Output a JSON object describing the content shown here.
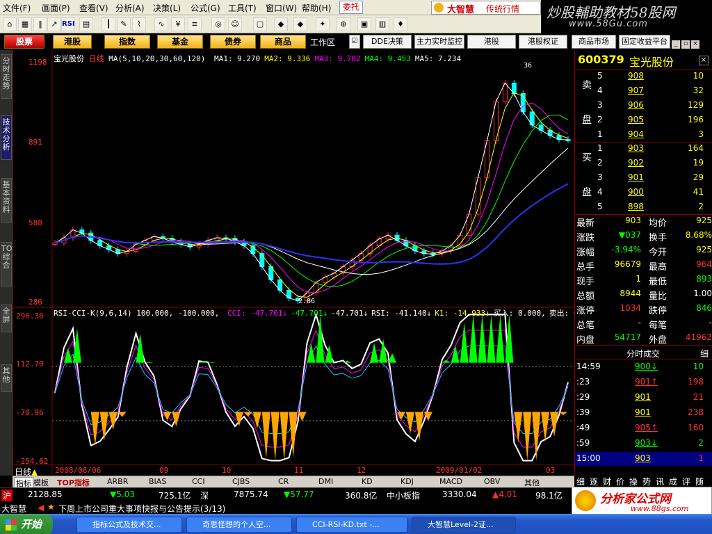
{
  "menu": [
    "文件(F)",
    "画面(P)",
    "查看(V)",
    "分析(A)",
    "决策(L)",
    "公式(G)",
    "工具(T)",
    "窗口(W)",
    "帮助(H)"
  ],
  "weituo": "委托",
  "brand": {
    "name": "大智慧",
    "sub": "传统行情"
  },
  "watermark_top": {
    "line1": "炒股輔助教材58股网",
    "line2": "www.58Gu.com"
  },
  "func_buttons": [
    "股票",
    "港股",
    "指数",
    "基金",
    "债券",
    "商品"
  ],
  "workzone": "工作区",
  "work_buttons": [
    "DDE决策",
    "主力实时监控",
    "港股",
    "港股权证",
    "商品市场",
    "固定收益平台"
  ],
  "left_tabs": [
    "分时走势",
    "技术分析",
    "基本资料",
    "TOP综合",
    "全屏",
    "其他"
  ],
  "chart": {
    "title": "宝光股份",
    "period": "日线",
    "ma_params": "MA(5,10,20,30,60,120)",
    "ma_readouts": [
      {
        "label": "MA1: 9.270",
        "color": "#ffffff"
      },
      {
        "label": "MA2: 9.336",
        "color": "#ffff00"
      },
      {
        "label": "MA3: 9.702",
        "color": "#ff00ff"
      },
      {
        "label": "MA4: 9.453",
        "color": "#00ff00"
      },
      {
        "label": "MA5: 7.234",
        "color": "#ffffff"
      }
    ],
    "price_axis": [
      "1198",
      "891",
      "588",
      "286"
    ],
    "low_marker": "2.86",
    "high_marker": "36",
    "ind_title": "RSI-CCI-K(9,6,14)",
    "ind_vals": "100.000, -100.000,",
    "ind_readouts": [
      {
        "label": "CCI: -47.701↓",
        "color": "#ff00ff"
      },
      {
        "label": "-47.701↓",
        "color": "#00ff00"
      },
      {
        "label": "-47.701↓",
        "color": "#ffffff"
      },
      {
        "label": "RSI: -41.140↓",
        "color": "#ffffff"
      },
      {
        "label": "K1: -14.933↓",
        "color": "#ffff00"
      },
      {
        "label": "买入: 0.000,",
        "color": "#ffffff"
      },
      {
        "label": "卖出: 0.000,",
        "color": "#ffffff"
      }
    ],
    "ind_axis": [
      "296.36",
      "112.70",
      "-70.96",
      "-254.62"
    ],
    "date_axis": [
      "2008/08/06",
      "09",
      "10",
      "11",
      "12",
      "2009/01/02",
      "03"
    ],
    "bottom_label": "日线"
  },
  "chart_data": {
    "type": "line",
    "series": [
      {
        "values": [
          510,
          530,
          560,
          548,
          520,
          500,
          485,
          470,
          478,
          505,
          520,
          535,
          528,
          515,
          505,
          495,
          505,
          520,
          530,
          528,
          515,
          500,
          470,
          420,
          370,
          330,
          300,
          290,
          320,
          360,
          380,
          395,
          420,
          445,
          470,
          500,
          525,
          540,
          520,
          500,
          480,
          470,
          468,
          480,
          500,
          540,
          620,
          760,
          900,
          1050,
          1120,
          1080,
          1010,
          960,
          940,
          920,
          905,
          903
        ]
      }
    ]
  },
  "quote": {
    "code": "600379",
    "name": "宝光股份",
    "sell_label": [
      "卖",
      "盘"
    ],
    "buy_label": [
      "买",
      "盘"
    ],
    "sell": [
      [
        "5",
        "908",
        "10"
      ],
      [
        "4",
        "907",
        "32"
      ],
      [
        "3",
        "906",
        "129"
      ],
      [
        "2",
        "905",
        "196"
      ],
      [
        "1",
        "904",
        "3"
      ]
    ],
    "buy": [
      [
        "1",
        "903",
        "164"
      ],
      [
        "2",
        "902",
        "19"
      ],
      [
        "3",
        "901",
        "29"
      ],
      [
        "4",
        "900",
        "41"
      ],
      [
        "5",
        "898",
        "2"
      ]
    ],
    "stats": [
      [
        "最新",
        "903",
        "#ffff00",
        "均价",
        "925",
        "#ffff00"
      ],
      [
        "涨跌",
        "▼037",
        "#00ff00",
        "换手",
        "8.68%",
        "#ffff00"
      ],
      [
        "涨幅",
        "-3.94%",
        "#00ff00",
        "今开",
        "925",
        "#ffff00"
      ],
      [
        "总手",
        "96679",
        "#ffff00",
        "最高",
        "964",
        "#ff3030"
      ],
      [
        "现手",
        "1",
        "#ffff00",
        "最低",
        "893",
        "#00ff00"
      ],
      [
        "总额",
        "8944",
        "#ffff00",
        "量比",
        "1.00",
        "#ffffff"
      ],
      [
        "涨停",
        "1034",
        "#ff3030",
        "跌停",
        "846",
        "#00ff00"
      ],
      [
        "总笔",
        "-",
        "#ffffff",
        "每笔",
        "-",
        "#ffffff"
      ],
      [
        "内盘",
        "54717",
        "#00ff00",
        "外盘",
        "41962",
        "#ff3030"
      ]
    ],
    "ticks_title": "分时成交",
    "ticks_side": "细",
    "ticks": [
      [
        "14:59",
        "900↓",
        "10",
        "#00ff00"
      ],
      [
        ":23",
        "901↑",
        "198",
        "#ff3030"
      ],
      [
        ":29",
        "901",
        "21",
        "#ffff00"
      ],
      [
        ":39",
        "901",
        "238",
        "#ffff00"
      ],
      [
        ":49",
        "905↑",
        "160",
        "#ff3030"
      ],
      [
        ":59",
        "903↓",
        "2",
        "#00ff00"
      ],
      [
        "15:00",
        "903",
        "1",
        "#ffff00"
      ]
    ],
    "bottom_tabs": [
      "细",
      "逐",
      "财",
      "价",
      "操",
      "势",
      "讯",
      "成",
      "评",
      "随"
    ]
  },
  "bottom_tabs": [
    "指标",
    "模板",
    "TOP指标",
    "ARBR",
    "BIAS",
    "CCI",
    "CJBS",
    "CR",
    "DMI",
    "KD",
    "KDJ",
    "MACD",
    "OBV",
    "其他"
  ],
  "status": {
    "sh_label": "沪",
    "sh_index": "2128.85",
    "sh_change": "▼5.03",
    "sh_amount": "725.1亿",
    "sz_label": "深",
    "sz_index": "7875.74",
    "sz_change": "▼57.77",
    "sz_amount": "360.8亿",
    "zx_label": "中小板指",
    "zx_index": "3330.04",
    "zx_change": "▲4.01",
    "zx_amount": "98.1亿"
  },
  "ticker": {
    "brand": "大智慧",
    "text": "下周上市公司重大事项快报与公告提示(3/13)"
  },
  "taskbar": {
    "start": "开始",
    "tasks": [
      "指标公式及技术交...",
      "奇思怪想的个人空...",
      "CCI-RSI-KD.txt -...",
      "大智慧Level-2证..."
    ]
  },
  "watermark_bottom": {
    "name": "分析家公式网",
    "url": "www.88gs.com"
  }
}
